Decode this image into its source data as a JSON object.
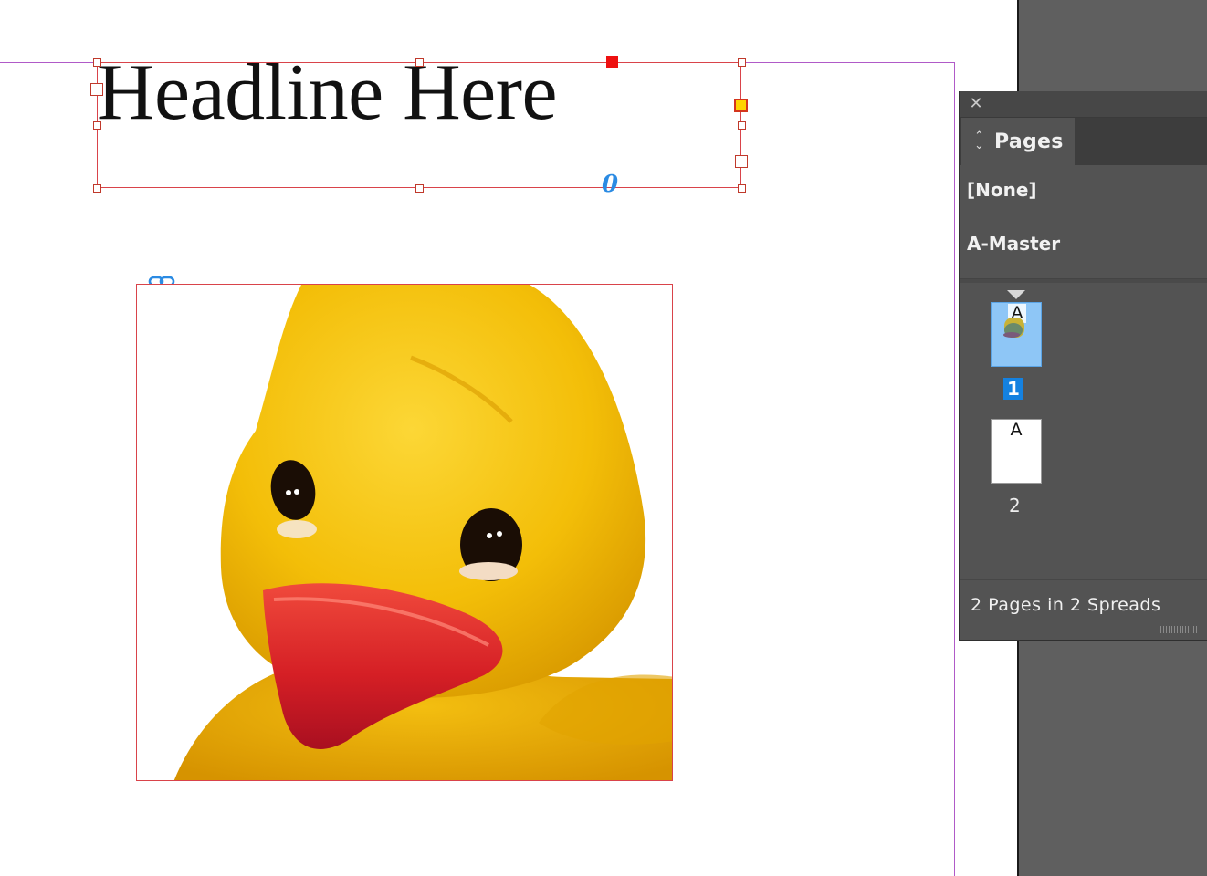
{
  "document": {
    "headline": "Headline Here",
    "overset_indicator": "0"
  },
  "pages_panel": {
    "tab_label": "Pages",
    "masters": [
      "[None]",
      "A-Master"
    ],
    "pages": [
      {
        "number": "1",
        "master_prefix": "A",
        "selected": true
      },
      {
        "number": "2",
        "master_prefix": "A",
        "selected": false
      }
    ],
    "footer": "2 Pages in 2 Spreads"
  },
  "colors": {
    "selection_frame": "#d9434a",
    "page_guide": "#b05ac8",
    "panel_bg": "#535353",
    "selected_page": "#1481e0",
    "link_icon": "#2b8be3"
  }
}
